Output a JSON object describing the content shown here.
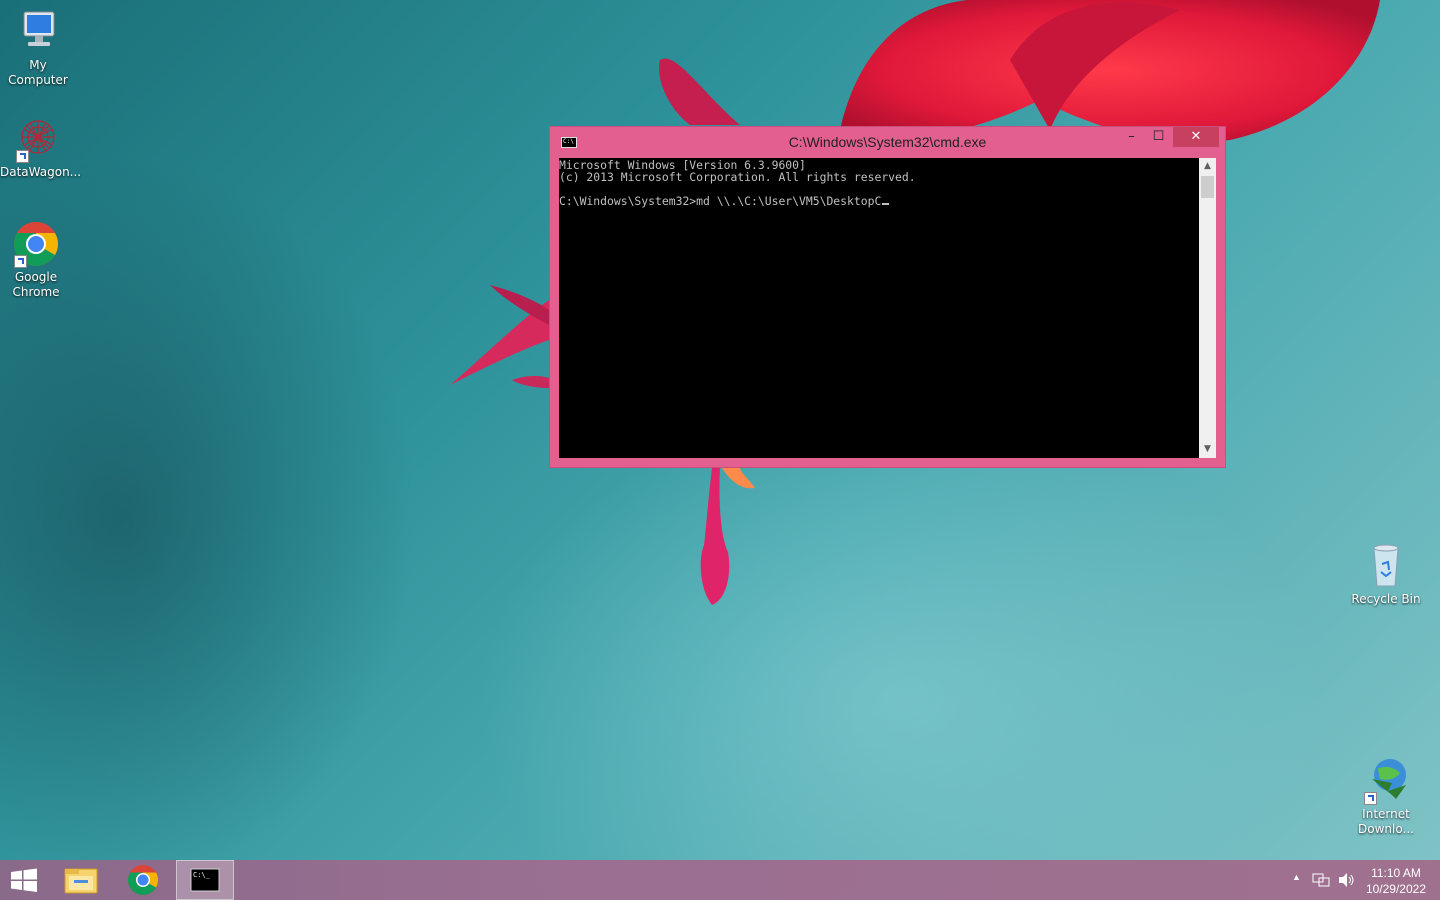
{
  "desktop": {
    "icons": [
      {
        "label": "My Computer",
        "icon": "my-computer-icon"
      },
      {
        "label": "DataWagon...",
        "icon": "datawagon-icon"
      },
      {
        "label": "Google Chrome",
        "icon": "chrome-icon"
      },
      {
        "label": "Recycle Bin",
        "icon": "recycle-bin-icon"
      },
      {
        "label": "Internet Downlo...",
        "icon": "internet-download-manager-icon"
      }
    ]
  },
  "cmd_window": {
    "title": "C:\\Windows\\System32\\cmd.exe",
    "minimize_label": "–",
    "maximize_label": "☐",
    "close_label": "✕",
    "console_lines": [
      "Microsoft Windows [Version 6.3.9600]",
      "(c) 2013 Microsoft Corporation. All rights reserved.",
      "",
      "C:\\Windows\\System32>md \\\\.\\C:\\User\\VM5\\DesktopC"
    ],
    "accent_color": "#e25f8f"
  },
  "taskbar": {
    "buttons": [
      {
        "name": "start",
        "icon": "windows-start-icon"
      },
      {
        "name": "file-explorer",
        "icon": "file-explorer-icon"
      },
      {
        "name": "chrome",
        "icon": "chrome-icon"
      },
      {
        "name": "cmd",
        "icon": "command-prompt-icon",
        "active": true
      }
    ],
    "tray_icons": [
      "show-hidden-icons-arrow",
      "network-icon",
      "volume-icon"
    ],
    "time": "11:10 AM",
    "date": "10/29/2022"
  }
}
